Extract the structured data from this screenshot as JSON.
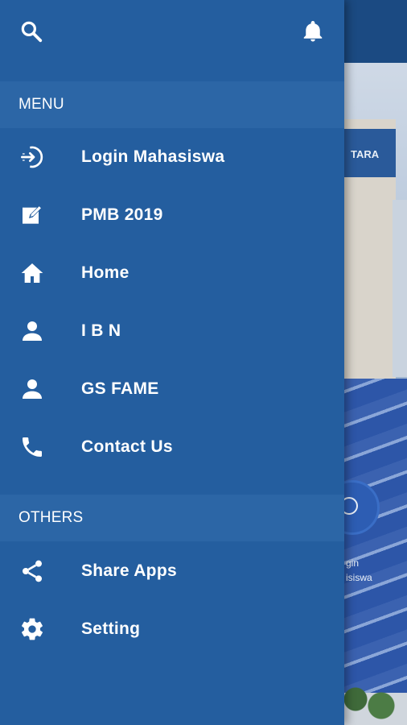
{
  "background": {
    "building_sign": "TARA",
    "fab_label_line1": "gin",
    "fab_label_line2": "isiswa"
  },
  "drawer": {
    "header": {
      "search_icon": "search-icon",
      "notification_icon": "bell-icon"
    },
    "sections": [
      {
        "title": "MENU",
        "items": [
          {
            "label": "Login Mahasiswa",
            "icon": "login-icon"
          },
          {
            "label": "PMB 2019",
            "icon": "edit-icon"
          },
          {
            "label": "Home",
            "icon": "home-icon"
          },
          {
            "label": "I B N",
            "icon": "person-icon"
          },
          {
            "label": "GS FAME",
            "icon": "person-icon"
          },
          {
            "label": "Contact Us",
            "icon": "phone-icon"
          }
        ]
      },
      {
        "title": "OTHERS",
        "items": [
          {
            "label": "Share Apps",
            "icon": "share-icon"
          },
          {
            "label": "Setting",
            "icon": "gear-icon"
          }
        ]
      }
    ]
  },
  "colors": {
    "drawer_bg": "#245e9f",
    "section_bg": "#2c66a6",
    "text": "#ffffff"
  }
}
